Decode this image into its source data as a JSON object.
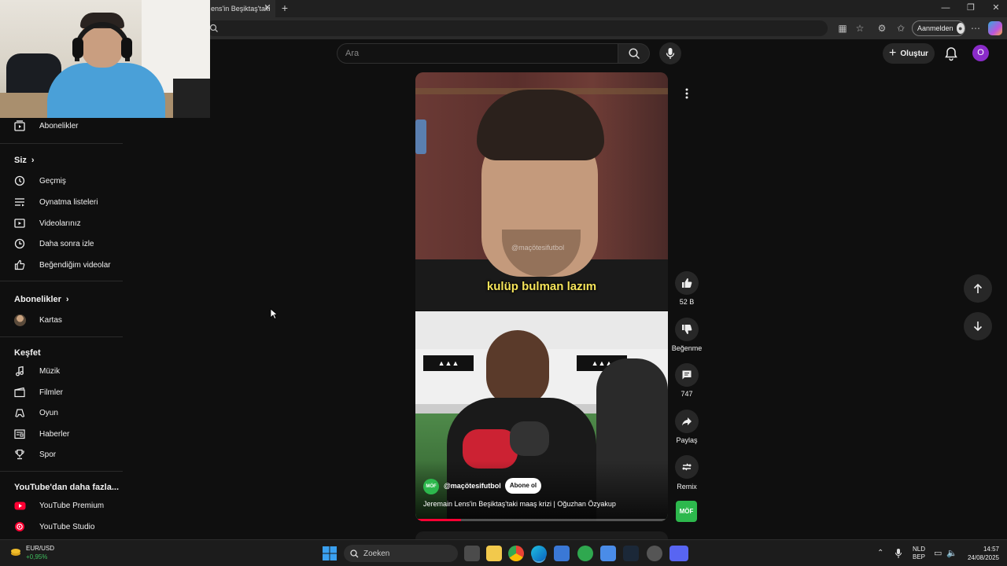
{
  "browser": {
    "tab_title": "ens'in Beşiktaş'taki",
    "signin_label": "Aanmelden"
  },
  "header": {
    "search_placeholder": "Ara",
    "create_label": "Oluştur",
    "account_initial": "O"
  },
  "sidebar": {
    "top_item": "Abonelikler",
    "you_header": "Siz",
    "you_items": [
      {
        "label": "Geçmiş",
        "icon": "history-icon"
      },
      {
        "label": "Oynatma listeleri",
        "icon": "playlist-icon"
      },
      {
        "label": "Videolarınız",
        "icon": "your-videos-icon"
      },
      {
        "label": "Daha sonra izle",
        "icon": "watch-later-icon"
      },
      {
        "label": "Beğendiğim videolar",
        "icon": "liked-icon"
      }
    ],
    "subs_header": "Abonelikler",
    "subs_items": [
      {
        "label": "Kartas"
      }
    ],
    "explore_header": "Keşfet",
    "explore_items": [
      {
        "label": "Müzik",
        "icon": "music-icon"
      },
      {
        "label": "Filmler",
        "icon": "movies-icon"
      },
      {
        "label": "Oyun",
        "icon": "gaming-icon"
      },
      {
        "label": "Haberler",
        "icon": "news-icon"
      },
      {
        "label": "Spor",
        "icon": "sports-icon"
      }
    ],
    "more_header": "YouTube'dan daha fazla...",
    "more_items": [
      {
        "label": "YouTube Premium"
      },
      {
        "label": "YouTube Studio"
      }
    ]
  },
  "short": {
    "subtitle": "kulüp bulman lazım",
    "watermark": "@maçötesifutbol",
    "channel": "@maçötesifutbol",
    "channel_badge": "MÖF",
    "subscribe": "Abone ol",
    "title": "Jeremain Lens'in Beşiktaş'taki maaş krizi | Oğuzhan Özyakup",
    "likes": "52 B",
    "dislike_label": "Beğenme",
    "comments": "747",
    "share_label": "Paylaş",
    "remix_label": "Remix"
  },
  "taskbar": {
    "ticker_name": "EUR/USD",
    "ticker_change": "+0,95%",
    "search_label": "Zoeken",
    "lang_top": "NLD",
    "lang_bottom": "BEP",
    "time": "14:57",
    "date": "24/08/2025"
  },
  "colors": {
    "background": "#0f0f0f",
    "surface": "#272727",
    "account": "#8a2bc9",
    "ticker_positive": "#3fbf5f",
    "youtube_red": "#ff0033"
  }
}
